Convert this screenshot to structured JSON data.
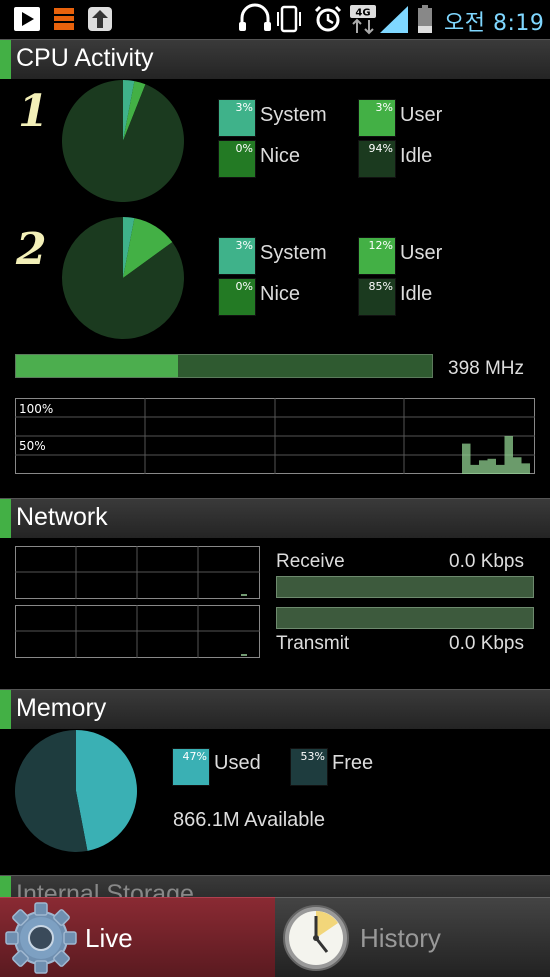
{
  "status_bar": {
    "network_badge": "4G",
    "time": "오전 8:19",
    "icons": [
      "play-store-icon",
      "app-icon",
      "upload-icon",
      "headset-icon",
      "vibrate-icon",
      "alarm-icon",
      "data-transfer-icon",
      "signal-icon",
      "battery-icon"
    ]
  },
  "cpu": {
    "title": "CPU Activity",
    "cores": [
      {
        "number": "1",
        "stats": {
          "system": {
            "label": "System",
            "pct_text": "3%",
            "value": 3
          },
          "user": {
            "label": "User",
            "pct_text": "3%",
            "value": 3
          },
          "nice": {
            "label": "Nice",
            "pct_text": "0%",
            "value": 0
          },
          "idle": {
            "label": "Idle",
            "pct_text": "94%",
            "value": 94
          }
        }
      },
      {
        "number": "2",
        "stats": {
          "system": {
            "label": "System",
            "pct_text": "3%",
            "value": 3
          },
          "user": {
            "label": "User",
            "pct_text": "12%",
            "value": 12
          },
          "nice": {
            "label": "Nice",
            "pct_text": "0%",
            "value": 0
          },
          "idle": {
            "label": "Idle",
            "pct_text": "85%",
            "value": 85
          }
        }
      }
    ],
    "frequency": {
      "label": "398 MHz",
      "fill_fraction": 0.39
    },
    "history": {
      "label_100": "100%",
      "label_50": "50%",
      "values": [
        40,
        12,
        18,
        20,
        12,
        50,
        22,
        14
      ]
    }
  },
  "network": {
    "title": "Network",
    "receive": {
      "label": "Receive",
      "value": "0.0 Kbps",
      "fill_fraction": 0
    },
    "transmit": {
      "label": "Transmit",
      "value": "0.0 Kbps",
      "fill_fraction": 0
    }
  },
  "memory": {
    "title": "Memory",
    "used": {
      "label": "Used",
      "pct_text": "47%",
      "value": 47
    },
    "free": {
      "label": "Free",
      "pct_text": "53%",
      "value": 53
    },
    "available": "866.1M Available"
  },
  "storage": {
    "title": "Internal Storage"
  },
  "tabs": {
    "live": {
      "label": "Live"
    },
    "history": {
      "label": "History"
    }
  },
  "colors": {
    "system": "#3fb28a",
    "user": "#43b045",
    "nice": "#237a24",
    "idle": "#1b3a1f",
    "mem_used": "#3ab0b4",
    "mem_free": "#1e3c3e",
    "accent": "#43b045"
  }
}
